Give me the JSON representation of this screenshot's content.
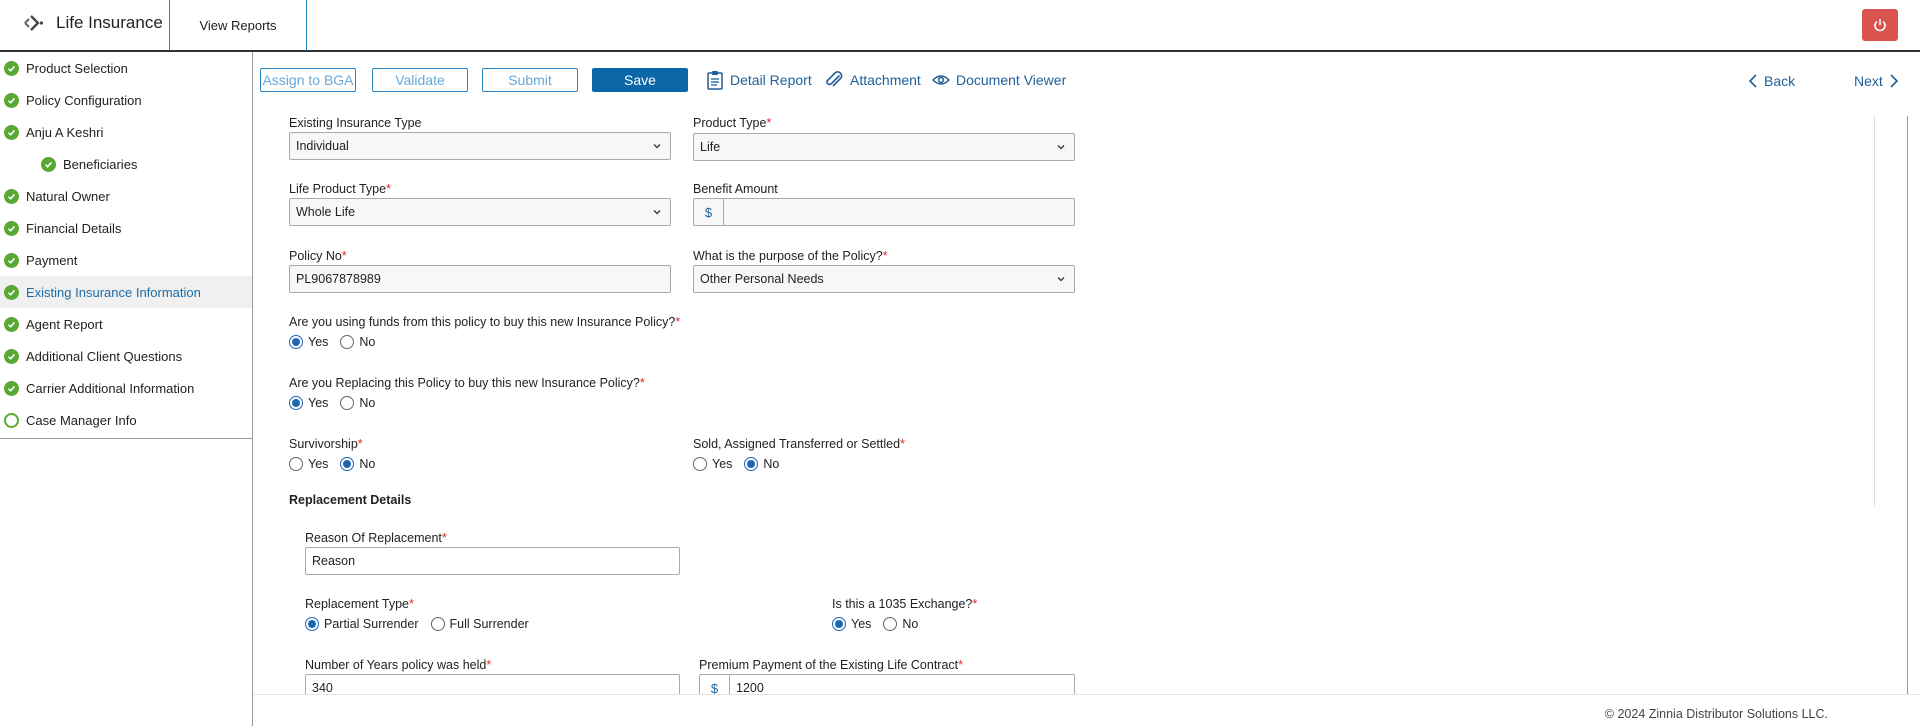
{
  "header": {
    "app_title": "Life Insurance",
    "view_reports": "View Reports"
  },
  "sidebar": {
    "items": [
      {
        "label": "Product Selection",
        "status": "complete"
      },
      {
        "label": "Policy Configuration",
        "status": "complete"
      },
      {
        "label": "Anju A Keshri",
        "status": "complete"
      },
      {
        "label": "Beneficiaries",
        "status": "complete"
      },
      {
        "label": "Natural Owner",
        "status": "complete"
      },
      {
        "label": "Financial Details",
        "status": "complete"
      },
      {
        "label": "Payment",
        "status": "complete"
      },
      {
        "label": "Existing Insurance Information",
        "status": "complete"
      },
      {
        "label": "Agent Report",
        "status": "complete"
      },
      {
        "label": "Additional Client Questions",
        "status": "complete"
      },
      {
        "label": "Carrier Additional Information",
        "status": "complete"
      },
      {
        "label": "Case Manager Info",
        "status": "incomplete"
      }
    ]
  },
  "toolbar": {
    "assign": "Assign to BGA",
    "validate": "Validate",
    "submit": "Submit",
    "save": "Save",
    "detail_report": "Detail Report",
    "attachment": "Attachment",
    "document_viewer": "Document Viewer",
    "back": "Back",
    "next": "Next"
  },
  "form": {
    "existing_insurance_type": {
      "label": "Existing Insurance Type",
      "value": "Individual"
    },
    "product_type": {
      "label": "Product Type",
      "value": "Life"
    },
    "life_product_type": {
      "label": "Life Product Type",
      "value": "Whole Life"
    },
    "benefit_amount": {
      "label": "Benefit Amount",
      "currency": "$",
      "value": ""
    },
    "policy_no": {
      "label": "Policy No",
      "value": "PL9067878989"
    },
    "purpose": {
      "label": "What is the purpose of the Policy?",
      "value": "Other Personal Needs"
    },
    "using_funds": {
      "label": "Are you using funds from this policy to buy this new Insurance Policy?",
      "yes": "Yes",
      "no": "No",
      "selected": "Yes"
    },
    "replacing": {
      "label": "Are you Replacing this Policy to buy this new Insurance Policy?",
      "yes": "Yes",
      "no": "No",
      "selected": "Yes"
    },
    "survivorship": {
      "label": "Survivorship",
      "yes": "Yes",
      "no": "No",
      "selected": "No"
    },
    "sold_assigned": {
      "label": "Sold, Assigned Transferred or Settled",
      "yes": "Yes",
      "no": "No",
      "selected": "No"
    },
    "replacement_details": "Replacement Details",
    "reason_of_replacement": {
      "label": "Reason Of Replacement",
      "value": "Reason"
    },
    "replacement_type": {
      "label": "Replacement Type",
      "partial": "Partial Surrender",
      "full": "Full Surrender",
      "selected": "Partial Surrender"
    },
    "exchange_1035": {
      "label": "Is this a 1035 Exchange?",
      "yes": "Yes",
      "no": "No",
      "selected": "Yes"
    },
    "years_held": {
      "label": "Number of Years policy was held",
      "value": "340"
    },
    "premium_payment": {
      "label": "Premium Payment of the Existing Life Contract",
      "currency": "$",
      "value": "1200"
    }
  },
  "footer": {
    "copyright": "© 2024 Zinnia Distributor Solutions LLC."
  },
  "colors": {
    "accent": "#0b67a8",
    "complete": "#5aa832",
    "required": "#e0262b",
    "power": "#d9534f"
  }
}
